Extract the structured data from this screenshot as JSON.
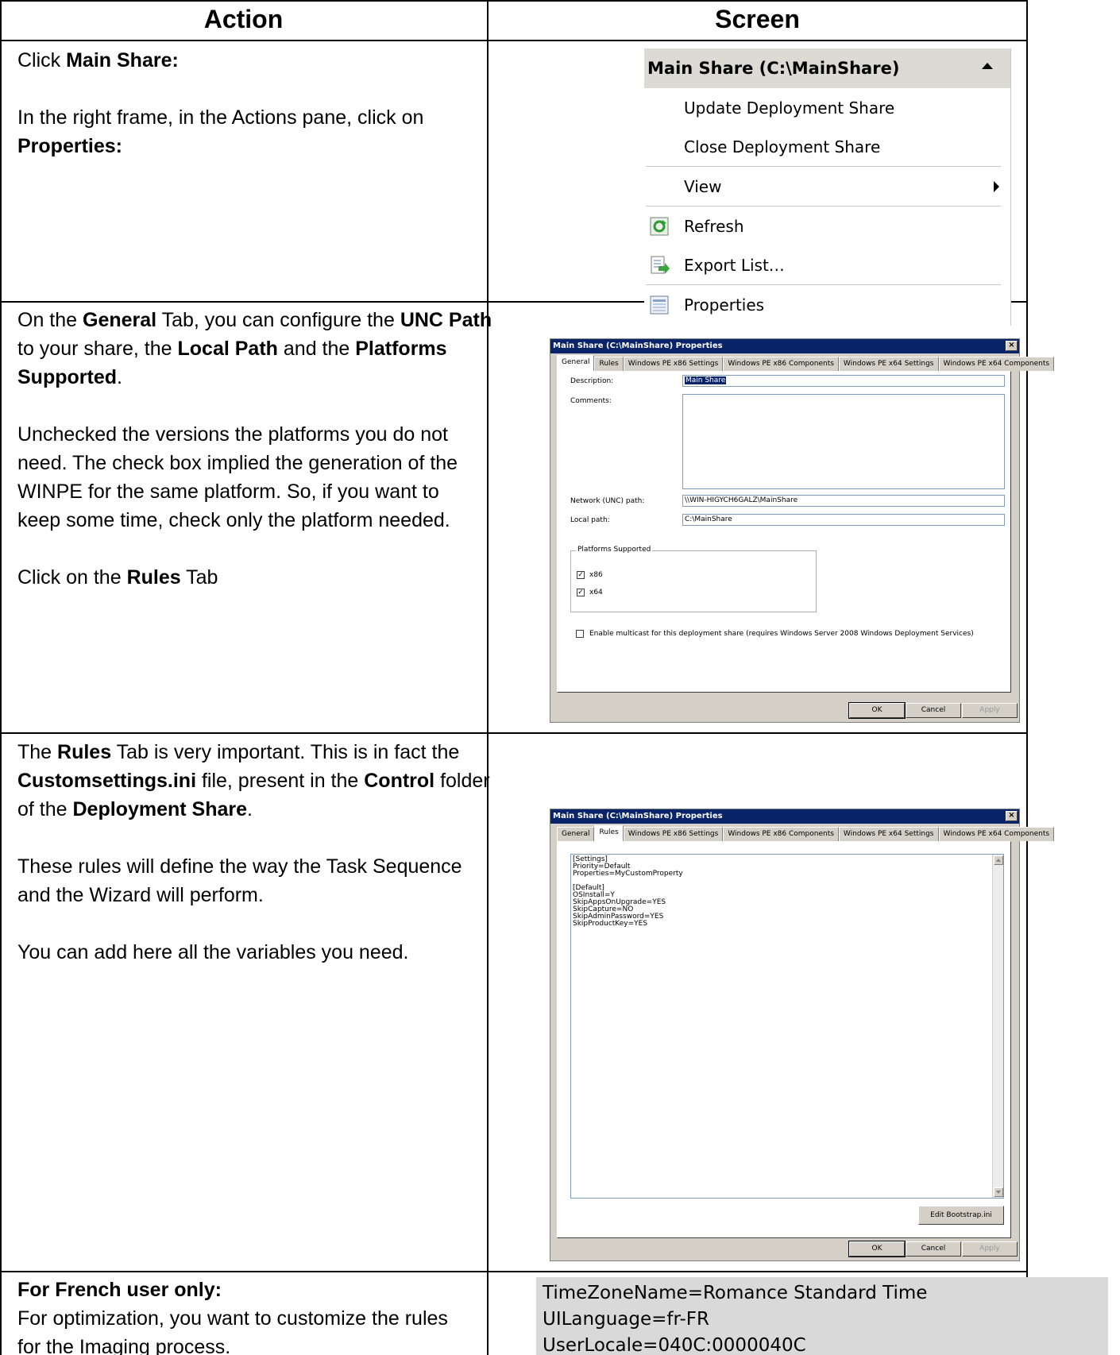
{
  "headers": {
    "action": "Action",
    "screen": "Screen"
  },
  "row1": {
    "p1_pre": "Click ",
    "p1_bold": "Main Share:",
    "p2_pre": "In the right frame, in the Actions pane, click on",
    "p2_bold": "Properties:"
  },
  "menu": {
    "header": "Main Share (C:\\MainShare)",
    "items": [
      "Update Deployment Share",
      "Close Deployment Share",
      "View",
      "Refresh",
      "Export List…",
      "Properties"
    ]
  },
  "row2": {
    "a": "On the ",
    "b": "General",
    "c": " Tab, you can configure the ",
    "d": "UNC Path",
    "e": "to your share, the ",
    "f": "Local Path",
    "g": " and the ",
    "h": "Platforms",
    "i": "Supported",
    "j": ".",
    "p2_l1": "Unchecked the versions the platforms you do not",
    "p2_l2": "need. The check box implied the generation of the",
    "p2_l3": "WINPE for the same platform. So, if you want to",
    "p2_l4": "keep some time, check only the platform needed.",
    "p3_pre": "Click on the ",
    "p3_bold": "Rules",
    "p3_post": " Tab"
  },
  "dialog": {
    "title": "Main Share (C:\\MainShare) Properties",
    "close": "×",
    "tabs": [
      "General",
      "Rules",
      "Windows PE x86 Settings",
      "Windows PE x86 Components",
      "Windows PE x64 Settings",
      "Windows PE x64 Components"
    ],
    "description_label": "Description:",
    "description_value": "Main Share",
    "comments_label": "Comments:",
    "unc_label": "Network (UNC) path:",
    "unc_value": "\\\\WIN-HIGYCH6GALZ\\MainShare",
    "local_label": "Local path:",
    "local_value": "C:\\MainShare",
    "platforms_label": "Platforms Supported",
    "x86_label": "x86",
    "x64_label": "x64",
    "multicast_label": "Enable multicast for this deployment share (requires Windows Server 2008 Windows Deployment Services)",
    "ok": "OK",
    "cancel": "Cancel",
    "apply": "Apply",
    "check": "✓",
    "edit_bootstrap": "Edit Bootstrap.ini",
    "rules_lines": [
      "[Settings]",
      "Priority=Default",
      "Properties=MyCustomProperty",
      "",
      "[Default]",
      "OSInstall=Y",
      "SkipAppsOnUpgrade=YES",
      "SkipCapture=NO",
      "SkipAdminPassword=YES",
      "SkipProductKey=YES"
    ]
  },
  "row3": {
    "a": "The ",
    "b": "Rules",
    "c": " Tab is very important. This is in fact the",
    "d": "Customsettings.ini",
    "e": " file, present in the ",
    "f": "Control",
    "g": " folder",
    "h": "of the ",
    "i": "Deployment Share",
    "j": ".",
    "p2_l1": "These rules will define the way the Task Sequence",
    "p2_l2": "and the Wizard will perform.",
    "p3": "You can add here all the variables you need."
  },
  "row4": {
    "bold": "For French user only:",
    "l1": "For optimization, you want to customize the rules",
    "l2": "for the Imaging process."
  },
  "code": [
    "TimeZoneName=Romance Standard Time",
    "UILanguage=fr-FR",
    "UserLocale=040C:0000040C"
  ]
}
